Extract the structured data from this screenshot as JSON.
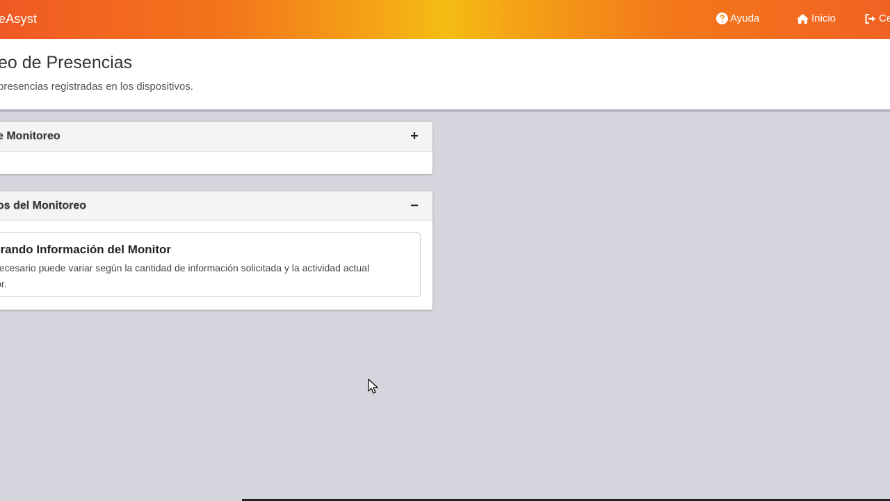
{
  "navbar": {
    "brand": "eAsyst",
    "links": [
      {
        "label": "Ayuda",
        "icon": "question-circle-icon"
      },
      {
        "label": "Inicio",
        "icon": "home-icon"
      },
      {
        "label": "Ce",
        "icon": "sign-out-icon"
      }
    ],
    "colors": {
      "start": "#f05a24",
      "middle": "#f4bd14",
      "end": "#f06224"
    }
  },
  "header": {
    "title": "eo de Presencias",
    "subtitle": "presencias registradas en los dispositivos."
  },
  "panels": [
    {
      "title": "e Monitoreo",
      "toggle": "plus",
      "expanded": false
    },
    {
      "title": "os del Monitoreo",
      "toggle": "minus",
      "expanded": true
    }
  ],
  "info": {
    "title": "erando Información del Monitor",
    "text_line1": "necesario puede variar según la cantidad de información solicitada y la actividad actual",
    "text_line2": "lor."
  }
}
